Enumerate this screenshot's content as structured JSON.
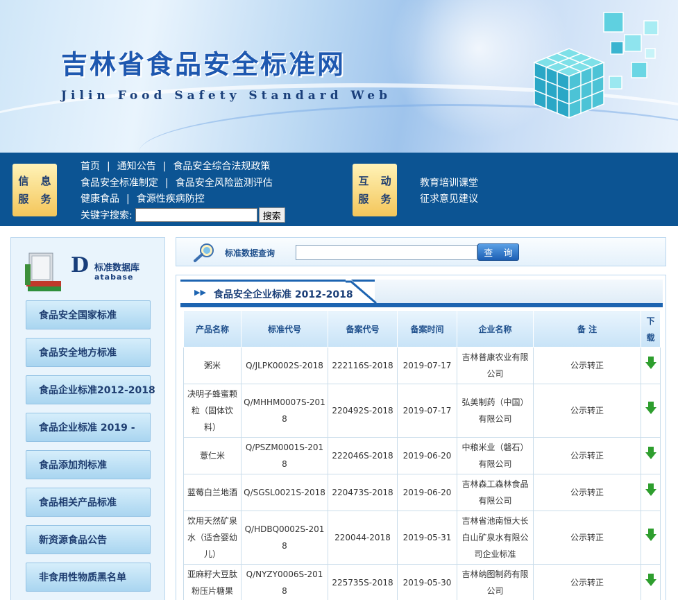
{
  "header": {
    "title": "吉林省食品安全标准网",
    "subtitle": "Jilin Food Safety Standard Web"
  },
  "nav": {
    "info_badge": [
      "信 息",
      "服 务"
    ],
    "interact_badge": [
      "互 动",
      "服 务"
    ],
    "line1": [
      "首页",
      "通知公告",
      "食品安全综合法规政策"
    ],
    "line2": [
      "食品安全标准制定",
      "食品安全风险监测评估"
    ],
    "line3": [
      "健康食品",
      "食源性疾病防控"
    ],
    "search_label": "关键字搜索:",
    "search_button": "搜索",
    "interact_links": [
      "教育培训课堂",
      "征求意见建议"
    ],
    "separator": "|"
  },
  "sidebar": {
    "db_letter": "D",
    "db_title": "标准数据库",
    "db_en": "atabase",
    "items": [
      "食品安全国家标准",
      "食品安全地方标准",
      "食品企业标准2012-2018",
      "食品企业标准 2019 -",
      "食品添加剂标准",
      "食品相关产品标准",
      "新资源食品公告",
      "非食用性物质黑名单"
    ]
  },
  "query": {
    "label": "标准数据查询",
    "button": "查 询"
  },
  "panel": {
    "title": "食品安全企业标准 2012-2018",
    "arrow": "▶▶",
    "columns": [
      "产品名称",
      "标准代号",
      "备案代号",
      "备案时间",
      "企业名称",
      "备 注",
      "下载"
    ],
    "rows": [
      [
        "粥米",
        "Q/JLPK0002S-2018",
        "222116S-2018",
        "2019-07-17",
        "吉林普康农业有限公司",
        "公示转正"
      ],
      [
        "决明子蜂蜜颗粒（固体饮料）",
        "Q/MHHM0007S-2018",
        "220492S-2018",
        "2019-07-17",
        "弘美制药（中国）有限公司",
        "公示转正"
      ],
      [
        "薏仁米",
        "Q/PSZM0001S-2018",
        "222046S-2018",
        "2019-06-20",
        "中粮米业（磐石）有限公司",
        "公示转正"
      ],
      [
        "蓝莓白兰地酒",
        "Q/SGSL0021S-2018",
        "220473S-2018",
        "2019-06-20",
        "吉林森工森林食品有限公司",
        "公示转正"
      ],
      [
        "饮用天然矿泉水（适合婴幼儿）",
        "Q/HDBQ0002S-2018",
        "220044-2018",
        "2019-05-31",
        "吉林省池南恒大长白山矿泉水有限公司企业标准",
        "公示转正"
      ],
      [
        "亚麻籽大豆肽粉压片糖果",
        "Q/NYZY0006S-2018",
        "225735S-2018",
        "2019-05-30",
        "吉林纳图制药有限公司",
        "公示转正"
      ]
    ]
  },
  "colors": {
    "nav_bg": "#0c5493",
    "accent": "#1d64b1",
    "title_blue": "#1e58b0",
    "download_green": "#2e9e2e"
  }
}
